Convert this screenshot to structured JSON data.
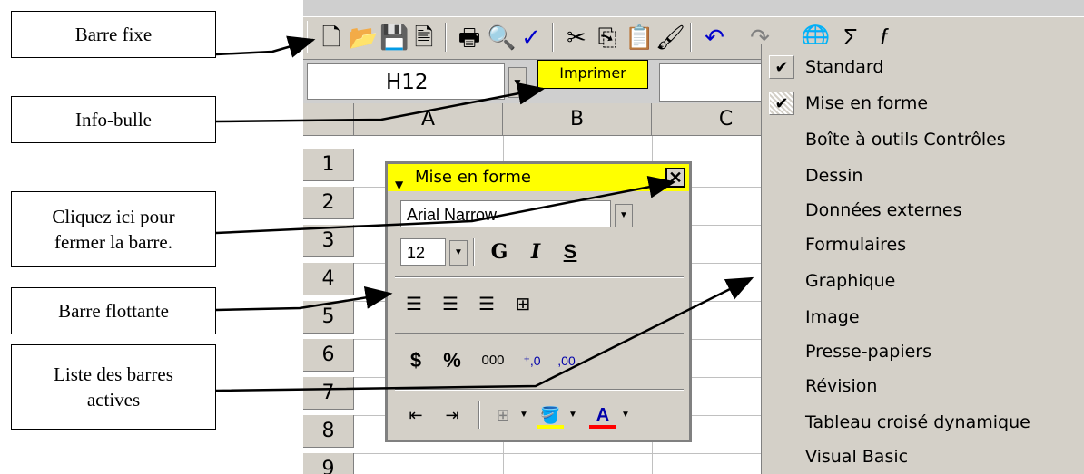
{
  "callouts": {
    "barre_fixe": "Barre fixe",
    "info_bulle": "Info-bulle",
    "cliquez_line1": "Cliquez ici pour",
    "cliquez_line2": "fermer la barre.",
    "barre_flottante": "Barre flottante",
    "liste_line1": "Liste des barres",
    "liste_line2": "actives"
  },
  "excel": {
    "name_box": "H12",
    "tooltip": "Imprimer",
    "columns": [
      "A",
      "B",
      "C"
    ],
    "rows": [
      "1",
      "2",
      "3",
      "4",
      "5",
      "6",
      "7",
      "8",
      "9"
    ]
  },
  "toolbar_icons": [
    "new-icon",
    "open-icon",
    "save-icon",
    "permission-icon",
    "print-icon",
    "print-preview-icon",
    "spelling-icon",
    "cut-icon",
    "copy-icon",
    "paste-icon",
    "format-painter-icon",
    "undo-icon",
    "redo-icon",
    "hyperlink-icon",
    "autosum-icon",
    "function-icon"
  ],
  "floating_toolbar": {
    "title": "Mise en forme",
    "font": "Arial Narrow",
    "size": "12",
    "bold": "G",
    "italic": "I",
    "underline": "S",
    "currency": "$",
    "percent": "%",
    "thousands": "000",
    "increase_decimal": "⁺,0",
    "decrease_decimal": ",00"
  },
  "menu": {
    "items": [
      {
        "label": "Standard",
        "checked": true
      },
      {
        "label": "Mise en forme",
        "checked": true
      },
      {
        "label": "Boîte à outils Contrôles",
        "checked": false
      },
      {
        "label": "Dessin",
        "checked": false
      },
      {
        "label": "Données externes",
        "checked": false
      },
      {
        "label": "Formulaires",
        "checked": false
      },
      {
        "label": "Graphique",
        "checked": false
      },
      {
        "label": "Image",
        "checked": false
      },
      {
        "label": "Presse-papiers",
        "checked": false
      },
      {
        "label": "Révision",
        "checked": false
      },
      {
        "label": "Tableau croisé dynamique",
        "checked": false
      },
      {
        "label": "Visual Basic",
        "checked": false
      }
    ]
  }
}
